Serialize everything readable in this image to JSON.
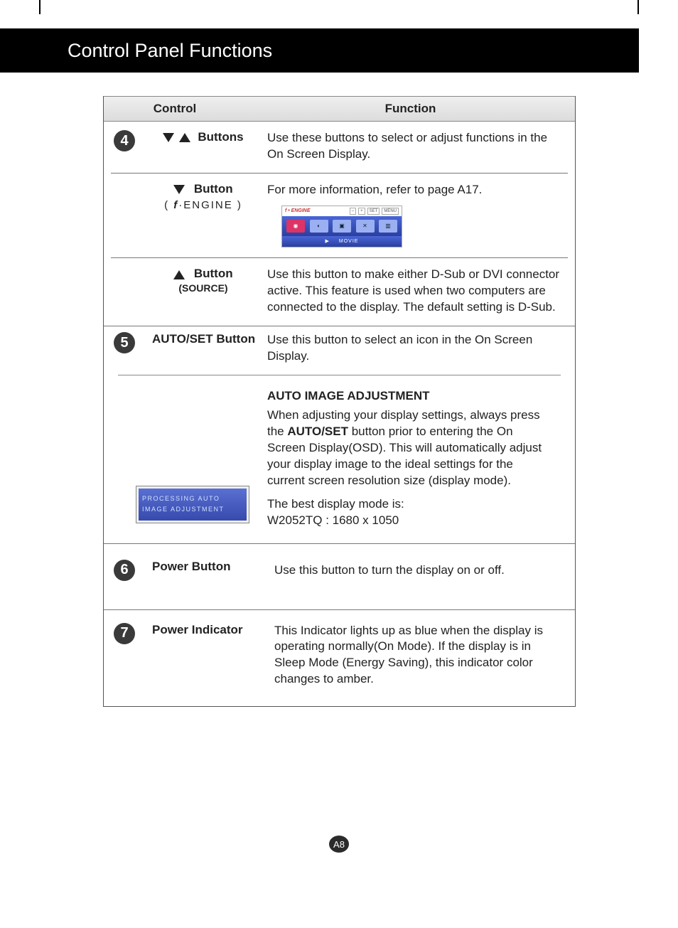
{
  "page": {
    "title": "Control Panel Functions",
    "number": "A8"
  },
  "table_header": {
    "control": "Control",
    "function": "Function"
  },
  "row4": {
    "badge": "4",
    "both": {
      "label": "Buttons",
      "desc": "Use these buttons to select or adjust functions in the On Screen Display."
    },
    "down": {
      "label": "Button",
      "sub": "ENGINE",
      "desc": "For more information, refer to page A17.",
      "osd": {
        "brand": "f • ENGINE",
        "hints": [
          "–",
          "+",
          "SET",
          "MENU"
        ],
        "cells_alt": [
          "user",
          "picture",
          "reset",
          "movie-bar"
        ],
        "footer_arrow": "▶",
        "footer_label": "MOVIE"
      }
    },
    "up": {
      "label": "Button",
      "sub": "(SOURCE)",
      "desc": "Use this button to make either D-Sub or DVI connector active. This feature is used when two computers are connected to the display. The default setting is D-Sub."
    }
  },
  "row5": {
    "badge": "5",
    "label": "AUTO/SET Button",
    "desc": "Use this button to select an icon in the On Screen Display.",
    "heading": "AUTO IMAGE ADJUSTMENT",
    "body_pre": "When adjusting your display settings, always press the ",
    "body_bold": "AUTO/SET",
    "body_post": " button prior to entering the On Screen Display(OSD). This will automatically adjust your display image to the ideal settings for the current screen resolution size (display mode).",
    "best_line": "The best display mode is:",
    "best_mode": "W2052TQ : 1680 x 1050",
    "proc_line1": "PROCESSING AUTO",
    "proc_line2": "IMAGE  ADJUSTMENT"
  },
  "row6": {
    "badge": "6",
    "label": "Power Button",
    "desc": "Use this button to turn the display on or off."
  },
  "row7": {
    "badge": "7",
    "label": "Power Indicator",
    "desc": "This Indicator lights up as blue when the display is operating normally(On Mode). If the display is in Sleep Mode (Energy Saving), this indicator color changes to amber."
  }
}
